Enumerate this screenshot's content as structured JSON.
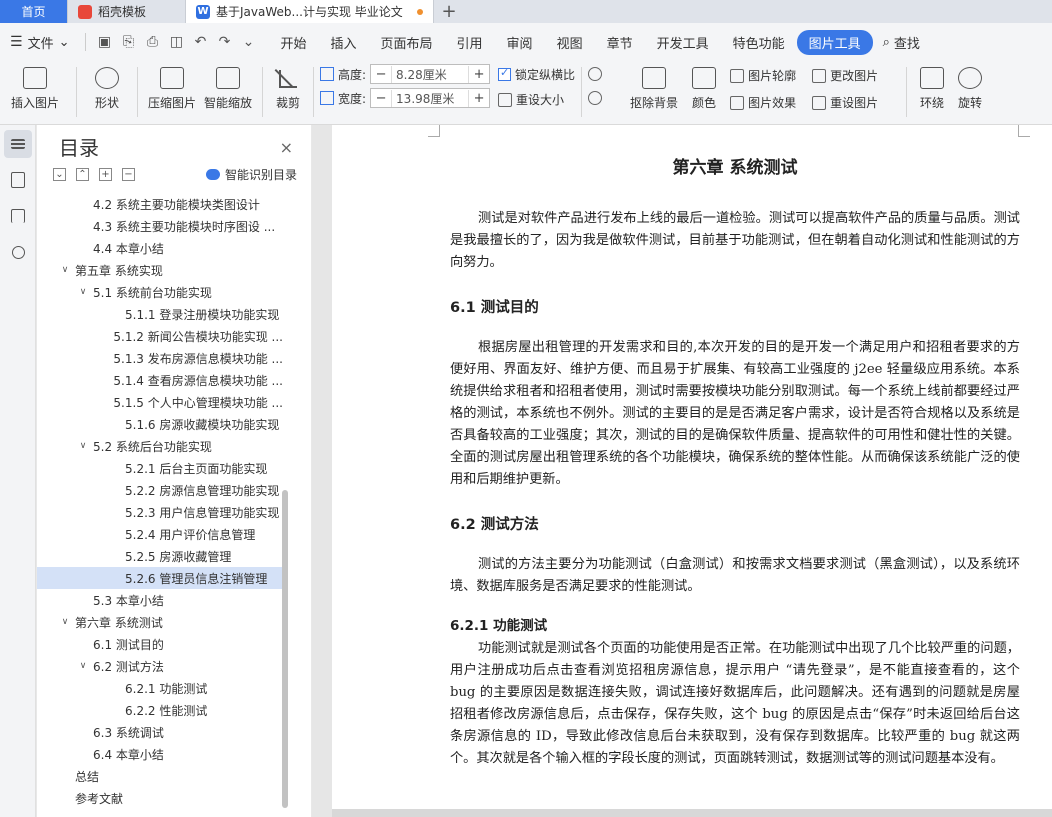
{
  "tabs": {
    "home": "首页",
    "template": "稻壳模板",
    "doc": "基于JavaWeb...计与实现 毕业论文",
    "add": "+"
  },
  "menu": {
    "file": "文件",
    "items": [
      "开始",
      "插入",
      "页面布局",
      "引用",
      "审阅",
      "视图",
      "章节",
      "开发工具",
      "特色功能"
    ],
    "active": "图片工具",
    "find": "查找"
  },
  "toolbar": {
    "insert_picture": "插入图片",
    "shape": "形状",
    "compress": "压缩图片",
    "smart_zoom": "智能缩放",
    "crop": "裁剪",
    "height_label": "高度:",
    "height_value": "8.28厘米",
    "width_label": "宽度:",
    "width_value": "13.98厘米",
    "lock_ratio": "锁定纵横比",
    "reset_size": "重设大小",
    "remove_bg": "抠除背景",
    "color": "颜色",
    "outline": "图片轮廓",
    "effect": "图片效果",
    "change_pic": "更改图片",
    "reset_pic": "重设图片",
    "wrap": "环绕",
    "rotate": "旋转",
    "minus": "−",
    "plus": "+"
  },
  "toc": {
    "title": "目录",
    "close": "×",
    "smart": "智能识别目录",
    "items": [
      {
        "text": "4.2 系统主要功能模块类图设计",
        "level": 2,
        "arrow": ""
      },
      {
        "text": "4.3 系统主要功能模块时序图设 ...",
        "level": 2,
        "arrow": ""
      },
      {
        "text": "4.4 本章小结",
        "level": 2,
        "arrow": ""
      },
      {
        "text": "第五章 系统实现",
        "level": 1,
        "arrow": "∨"
      },
      {
        "text": "5.1 系统前台功能实现",
        "level": 2,
        "arrow": "∨"
      },
      {
        "text": "5.1.1 登录注册模块功能实现",
        "level": 3,
        "arrow": ""
      },
      {
        "text": "5.1.2 新闻公告模块功能实现 ...",
        "level": 3,
        "arrow": ""
      },
      {
        "text": "5.1.3 发布房源信息模块功能 ...",
        "level": 3,
        "arrow": ""
      },
      {
        "text": "5.1.4 查看房源信息模块功能 ...",
        "level": 3,
        "arrow": ""
      },
      {
        "text": "5.1.5 个人中心管理模块功能 ...",
        "level": 3,
        "arrow": ""
      },
      {
        "text": "5.1.6 房源收藏模块功能实现",
        "level": 3,
        "arrow": ""
      },
      {
        "text": "5.2 系统后台功能实现",
        "level": 2,
        "arrow": "∨"
      },
      {
        "text": "5.2.1 后台主页面功能实现",
        "level": 3,
        "arrow": ""
      },
      {
        "text": "5.2.2 房源信息管理功能实现",
        "level": 3,
        "arrow": ""
      },
      {
        "text": "5.2.3 用户信息管理功能实现",
        "level": 3,
        "arrow": ""
      },
      {
        "text": "5.2.4 用户评价信息管理",
        "level": 3,
        "arrow": ""
      },
      {
        "text": "5.2.5 房源收藏管理",
        "level": 3,
        "arrow": ""
      },
      {
        "text": "5.2.6 管理员信息注销管理",
        "level": 3,
        "arrow": "",
        "selected": true
      },
      {
        "text": "5.3 本章小结",
        "level": 2,
        "arrow": ""
      },
      {
        "text": "第六章 系统测试",
        "level": 1,
        "arrow": "∨"
      },
      {
        "text": "6.1 测试目的",
        "level": 2,
        "arrow": ""
      },
      {
        "text": "6.2 测试方法",
        "level": 2,
        "arrow": "∨"
      },
      {
        "text": "6.2.1 功能测试",
        "level": 3,
        "arrow": ""
      },
      {
        "text": "6.2.2 性能测试",
        "level": 3,
        "arrow": ""
      },
      {
        "text": "6.3 系统调试",
        "level": 2,
        "arrow": ""
      },
      {
        "text": "6.4 本章小结",
        "level": 2,
        "arrow": ""
      },
      {
        "text": "总结",
        "level": 1,
        "arrow": ""
      },
      {
        "text": "参考文献",
        "level": 1,
        "arrow": ""
      }
    ]
  },
  "document": {
    "chapter": "第六章  系统测试",
    "p1": "测试是对软件产品进行发布上线的最后一道检验。测试可以提高软件产品的质量与品质。测试是我最擅长的了，因为我是做软件测试，目前基于功能测试，但在朝着自动化测试和性能测试的方向努力。",
    "h61": "6.1  测试目的",
    "p2": "根据房屋出租管理的开发需求和目的,本次开发的目的是开发一个满足用户和招租者要求的方便好用、界面友好、维护方便、而且易于扩展集、有较高工业强度的 j2ee 轻量级应用系统。本系统提供给求租者和招租者使用，测试时需要按模块功能分别取测试。每一个系统上线前都要经过严格的测试，本系统也不例外。测试的主要目的是是否满足客户需求，设计是否符合规格以及系统是否具备较高的工业强度；其次，测试的目的是确保软件质量、提高软件的可用性和健壮性的关键。全面的测试房屋出租管理系统的各个功能模块，确保系统的整体性能。从而确保该系统能广泛的使用和后期维护更新。",
    "h62": "6.2  测试方法",
    "p3": "测试的方法主要分为功能测试（白盒测试）和按需求文档要求测试（黑盒测试），以及系统环境、数据库服务是否满足要求的性能测试。",
    "h621": "6.2.1  功能测试",
    "p4": "功能测试就是测试各个页面的功能使用是否正常。在功能测试中出现了几个比较严重的问题，用户注册成功后点击查看浏览招租房源信息，提示用户 “请先登录”，是不能直接查看的，这个 bug 的主要原因是数据连接失败，调试连接好数据库后，此问题解决。还有遇到的问题就是房屋招租者修改房源信息后，点击保存，保存失败，这个 bug 的原因是点击“保存”时未返回给后台这条房源信息的 ID，导致此修改信息后台未获取到，没有保存到数据库。比较严重的 bug 就这两个。其次就是各个输入框的字段长度的测试，页面跳转测试，数据测试等的测试问题基本没有。"
  }
}
